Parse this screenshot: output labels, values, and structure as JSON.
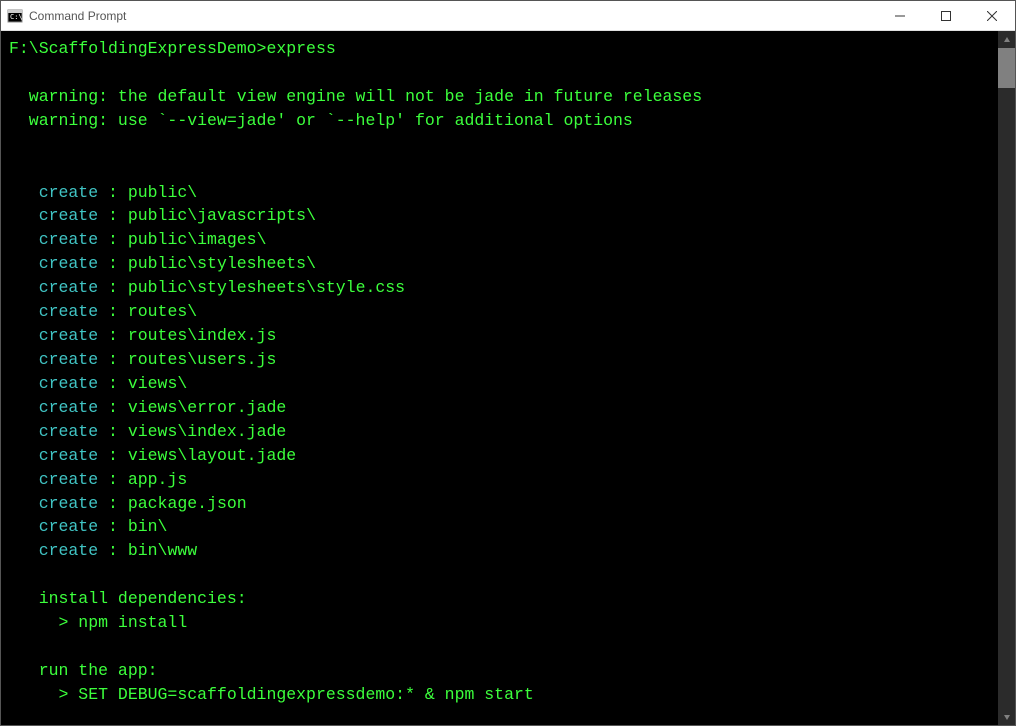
{
  "titlebar": {
    "title": "Command Prompt"
  },
  "prompt": "F:\\ScaffoldingExpressDemo>",
  "command": "express",
  "warnings": [
    "  warning: the default view engine will not be jade in future releases",
    "  warning: use `--view=jade' or `--help' for additional options"
  ],
  "creates": [
    {
      "label": "   create",
      "sep": " : ",
      "path": "public\\"
    },
    {
      "label": "   create",
      "sep": " : ",
      "path": "public\\javascripts\\"
    },
    {
      "label": "   create",
      "sep": " : ",
      "path": "public\\images\\"
    },
    {
      "label": "   create",
      "sep": " : ",
      "path": "public\\stylesheets\\"
    },
    {
      "label": "   create",
      "sep": " : ",
      "path": "public\\stylesheets\\style.css"
    },
    {
      "label": "   create",
      "sep": " : ",
      "path": "routes\\"
    },
    {
      "label": "   create",
      "sep": " : ",
      "path": "routes\\index.js"
    },
    {
      "label": "   create",
      "sep": " : ",
      "path": "routes\\users.js"
    },
    {
      "label": "   create",
      "sep": " : ",
      "path": "views\\"
    },
    {
      "label": "   create",
      "sep": " : ",
      "path": "views\\error.jade"
    },
    {
      "label": "   create",
      "sep": " : ",
      "path": "views\\index.jade"
    },
    {
      "label": "   create",
      "sep": " : ",
      "path": "views\\layout.jade"
    },
    {
      "label": "   create",
      "sep": " : ",
      "path": "app.js"
    },
    {
      "label": "   create",
      "sep": " : ",
      "path": "package.json"
    },
    {
      "label": "   create",
      "sep": " : ",
      "path": "bin\\"
    },
    {
      "label": "   create",
      "sep": " : ",
      "path": "bin\\www"
    }
  ],
  "install_header": "   install dependencies:",
  "install_cmd": "     > npm install",
  "run_header": "   run the app:",
  "run_cmd": "     > SET DEBUG=scaffoldingexpressdemo:* & npm start"
}
